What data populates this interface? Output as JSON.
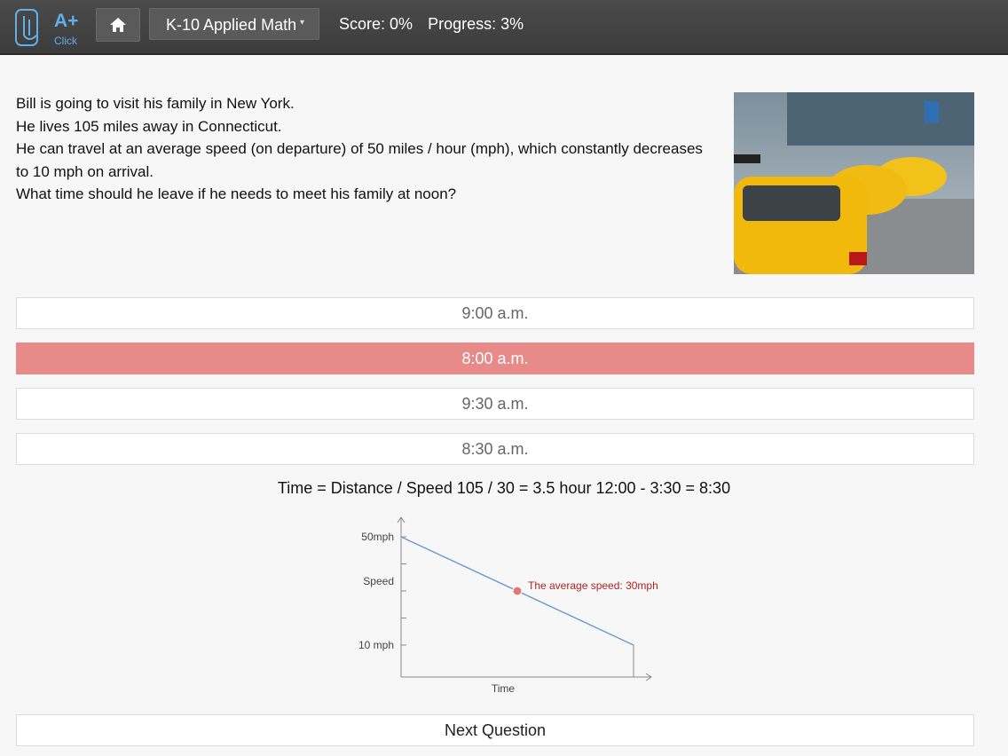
{
  "header": {
    "logo_text": "A+",
    "logo_sub": "Click",
    "course": "K-10 Applied Math",
    "score": "Score: 0%",
    "progress": "Progress: 3%"
  },
  "question": {
    "lines": [
      "Bill is going to visit his family in New York.",
      "He lives 105 miles away in Connecticut.",
      "He can travel at an average speed (on departure) of 50 miles / hour (mph), which constantly decreases to 10 mph on arrival.",
      "What time should he leave if he needs to meet his family at noon?"
    ]
  },
  "answers": [
    {
      "label": "9:00 a.m.",
      "state": "normal"
    },
    {
      "label": "8:00 a.m.",
      "state": "wrong"
    },
    {
      "label": "9:30 a.m.",
      "state": "normal"
    },
    {
      "label": "8:30 a.m.",
      "state": "normal"
    }
  ],
  "explanation": "Time = Distance / Speed 105 / 30 = 3.5 hour 12:00 - 3:30 = 8:30",
  "chart_data": {
    "type": "line",
    "xlabel": "Time",
    "ylabel": "Speed",
    "y_tick_labels": [
      "50mph",
      "10 mph"
    ],
    "series": [
      {
        "values": [
          50,
          10
        ]
      }
    ],
    "annotation": "The average speed: 30mph",
    "annotation_value": 30,
    "colors": {
      "line": "#6f9ccf",
      "annotation": "#b22222"
    }
  },
  "next_button": "Next Question",
  "colors": {
    "wrong": "#e68a8a",
    "topbar": "#444444",
    "logo": "#5fb0e8"
  }
}
